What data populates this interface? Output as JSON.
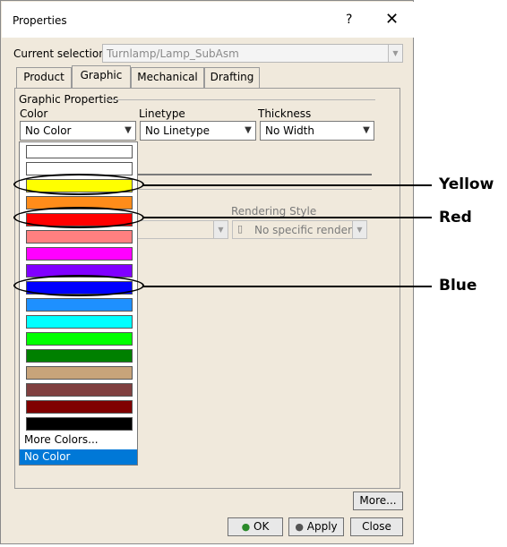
{
  "window": {
    "title": "Properties",
    "help_label": "?",
    "close_label": "✕"
  },
  "selection": {
    "label": "Current selection :",
    "value": "Turnlamp/Lamp_SubAsm"
  },
  "tabs": [
    {
      "label": "Product"
    },
    {
      "label": "Graphic"
    },
    {
      "label": "Mechanical"
    },
    {
      "label": "Drafting"
    }
  ],
  "active_tab": "Graphic",
  "graphic": {
    "section_title": "Graphic Properties",
    "color": {
      "label": "Color",
      "value": "No Color"
    },
    "linetype": {
      "label": "Linetype",
      "value": "No Linetype"
    },
    "thickness": {
      "label": "Thickness",
      "value": "No Width"
    },
    "rendering": {
      "label": "Rendering Style",
      "value": "No specific rendering"
    }
  },
  "color_list": {
    "swatches": [
      "#ffffff",
      "#ffffff",
      "#ffff00",
      "#ff8c1a",
      "#ff0000",
      "#ff8080",
      "#ff00ff",
      "#8000ff",
      "#0000ff",
      "#1e90ff",
      "#00ffff",
      "#00ff00",
      "#008000",
      "#c8a47a",
      "#804040",
      "#800000",
      "#000000"
    ],
    "more_colors": "More Colors...",
    "selected": "No Color"
  },
  "buttons": {
    "more": "More...",
    "ok": "OK",
    "apply": "Apply",
    "close": "Close"
  },
  "callouts": {
    "yellow": "Yellow",
    "red": "Red",
    "blue": "Blue"
  }
}
